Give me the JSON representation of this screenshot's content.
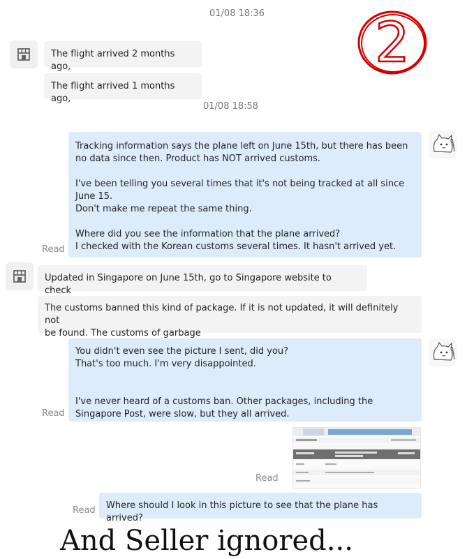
{
  "annotation": {
    "number": "2",
    "color": "#d40000"
  },
  "timestamps": [
    "01/08 18:36",
    "01/08 18:58"
  ],
  "messages": [
    {
      "from": "seller",
      "text": "The flight arrived 2 months ago,"
    },
    {
      "from": "seller",
      "text": "The flight arrived 1 months ago,"
    },
    {
      "from": "buyer",
      "text": "Tracking information says the plane left on June 15th, but there has been\nno data since then. Product has NOT arrived customs.\n\nI've been telling you several times that it's not being tracked at all since\nJune 15.\nDon't make me repeat the same thing.\n\nWhere did you see the information that the plane arrived?\nI checked with the Korean customs several times. It hasn't arrived yet.",
      "status": "Read"
    },
    {
      "from": "seller",
      "text": "Updated in Singapore on June 15th, go to Singapore website to check"
    },
    {
      "from": "seller",
      "text": "The customs banned this kind of package. If it is not updated, it will definitely not\nbe found. The customs of garbage"
    },
    {
      "from": "buyer",
      "text": "You didn't even see the picture I sent, did you?\nThat's too much. I'm very disappointed.\n\n\nI've never heard of a customs ban. Other packages, including the\nSingapore Post, were slow, but they all arrived.",
      "status": "Read"
    },
    {
      "from": "buyer",
      "type": "image",
      "status": "Read"
    },
    {
      "from": "buyer",
      "text": "Where should I look in this picture to see that the plane has arrived?",
      "status": "Read"
    }
  ],
  "caption": "And Seller ignored...",
  "icons": {
    "seller_avatar": "shop-avatar-icon",
    "buyer_avatar": "cat-avatar-icon"
  }
}
